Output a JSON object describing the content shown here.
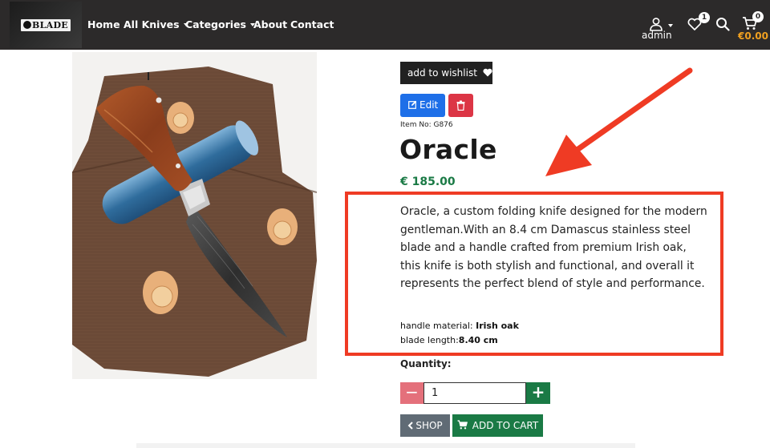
{
  "brand": {
    "logo_text": "BLADE"
  },
  "nav": {
    "links": [
      "Home",
      "All Knives",
      "Categories",
      "About",
      "Contact"
    ],
    "user_label": "admin",
    "wishlist_count": "1",
    "cart_count": "0",
    "cart_total": "€0.00"
  },
  "product": {
    "wishlist_label": "add to wishlist",
    "edit_label": "Edit",
    "item_no": "Item No: G876",
    "title": "Oracle",
    "price": "€ 185.00",
    "description": "Oracle, a custom folding knife designed for the modern gentleman.With an 8.4 cm Damascus stainless steel blade and a handle crafted from premium Irish oak, this knife is both stylish and functional, and overall it represents the perfect blend of style and performance.",
    "specs": [
      {
        "label": "handle material:",
        "value": "Irish oak"
      },
      {
        "label": "blade length:",
        "value": "8.40 cm"
      }
    ],
    "quantity_label": "Quantity:",
    "quantity_value": "1",
    "minus_label": "−",
    "plus_label": "+",
    "shop_label": "SHOP",
    "add_to_cart_label": "ADD TO CART"
  },
  "colors": {
    "navbar": "#2c2a2a",
    "price_green": "#1a7a45",
    "edit_blue": "#1e6fe8",
    "delete_red": "#dc3545",
    "annotation_red": "#ef3b24",
    "cart_total_orange": "#f0a020"
  },
  "icons": {
    "user": "user-icon",
    "wishlist": "heart-icon",
    "search": "search-icon",
    "cart": "cart-icon",
    "edit": "edit-icon",
    "delete": "trash-icon",
    "back": "chevron-left-icon"
  }
}
